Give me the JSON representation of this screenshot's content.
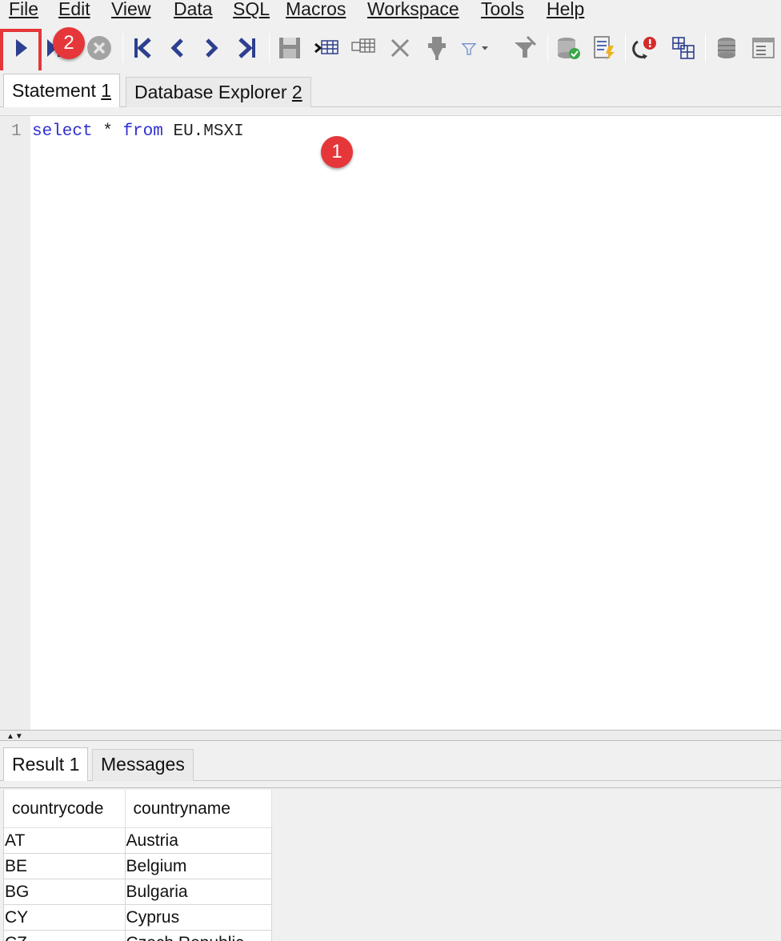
{
  "menu": [
    {
      "label": "File"
    },
    {
      "label": "Edit"
    },
    {
      "label": "View"
    },
    {
      "label": "Data"
    },
    {
      "label": "SQL"
    },
    {
      "label": "Macros"
    },
    {
      "label": "Workspace"
    },
    {
      "label": "Tools"
    },
    {
      "label": "Help"
    }
  ],
  "toolbar": {
    "icons": [
      "execute-current-icon",
      "execute-all-icon",
      "cancel-icon",
      "first-row-icon",
      "previous-row-icon",
      "next-row-icon",
      "last-row-icon",
      "save-icon",
      "insert-row-icon",
      "copy-row-icon",
      "delete-row-icon",
      "filter-icon",
      "filter-dropdown-icon",
      "reset-filter-icon",
      "commit-icon",
      "script-icon",
      "explain-icon",
      "data-grid-icon",
      "database-icon",
      "table-view-icon"
    ]
  },
  "annotations": {
    "badge_run": "2",
    "badge_query": "1",
    "highlight_color": "#e5363a"
  },
  "statement_tabs": [
    {
      "label": "Statement ",
      "num": "1"
    },
    {
      "label": "Database Explorer ",
      "num": "2"
    }
  ],
  "editor": {
    "line_number": "1",
    "tokens": [
      {
        "text": "select",
        "type": "keyword"
      },
      {
        "text": " * ",
        "type": "plain"
      },
      {
        "text": "from",
        "type": "keyword"
      },
      {
        "text": " EU.MSXI",
        "type": "plain"
      }
    ],
    "keyword_color": "#2f2fd2"
  },
  "result_tabs": [
    {
      "label": "Result 1"
    },
    {
      "label": "Messages"
    }
  ],
  "result": {
    "columns": [
      "countrycode",
      "countryname"
    ],
    "rows": [
      [
        "AT",
        "Austria"
      ],
      [
        "BE",
        "Belgium"
      ],
      [
        "BG",
        "Bulgaria"
      ],
      [
        "CY",
        "Cyprus"
      ],
      [
        "CZ",
        "Czech Republic"
      ]
    ]
  }
}
